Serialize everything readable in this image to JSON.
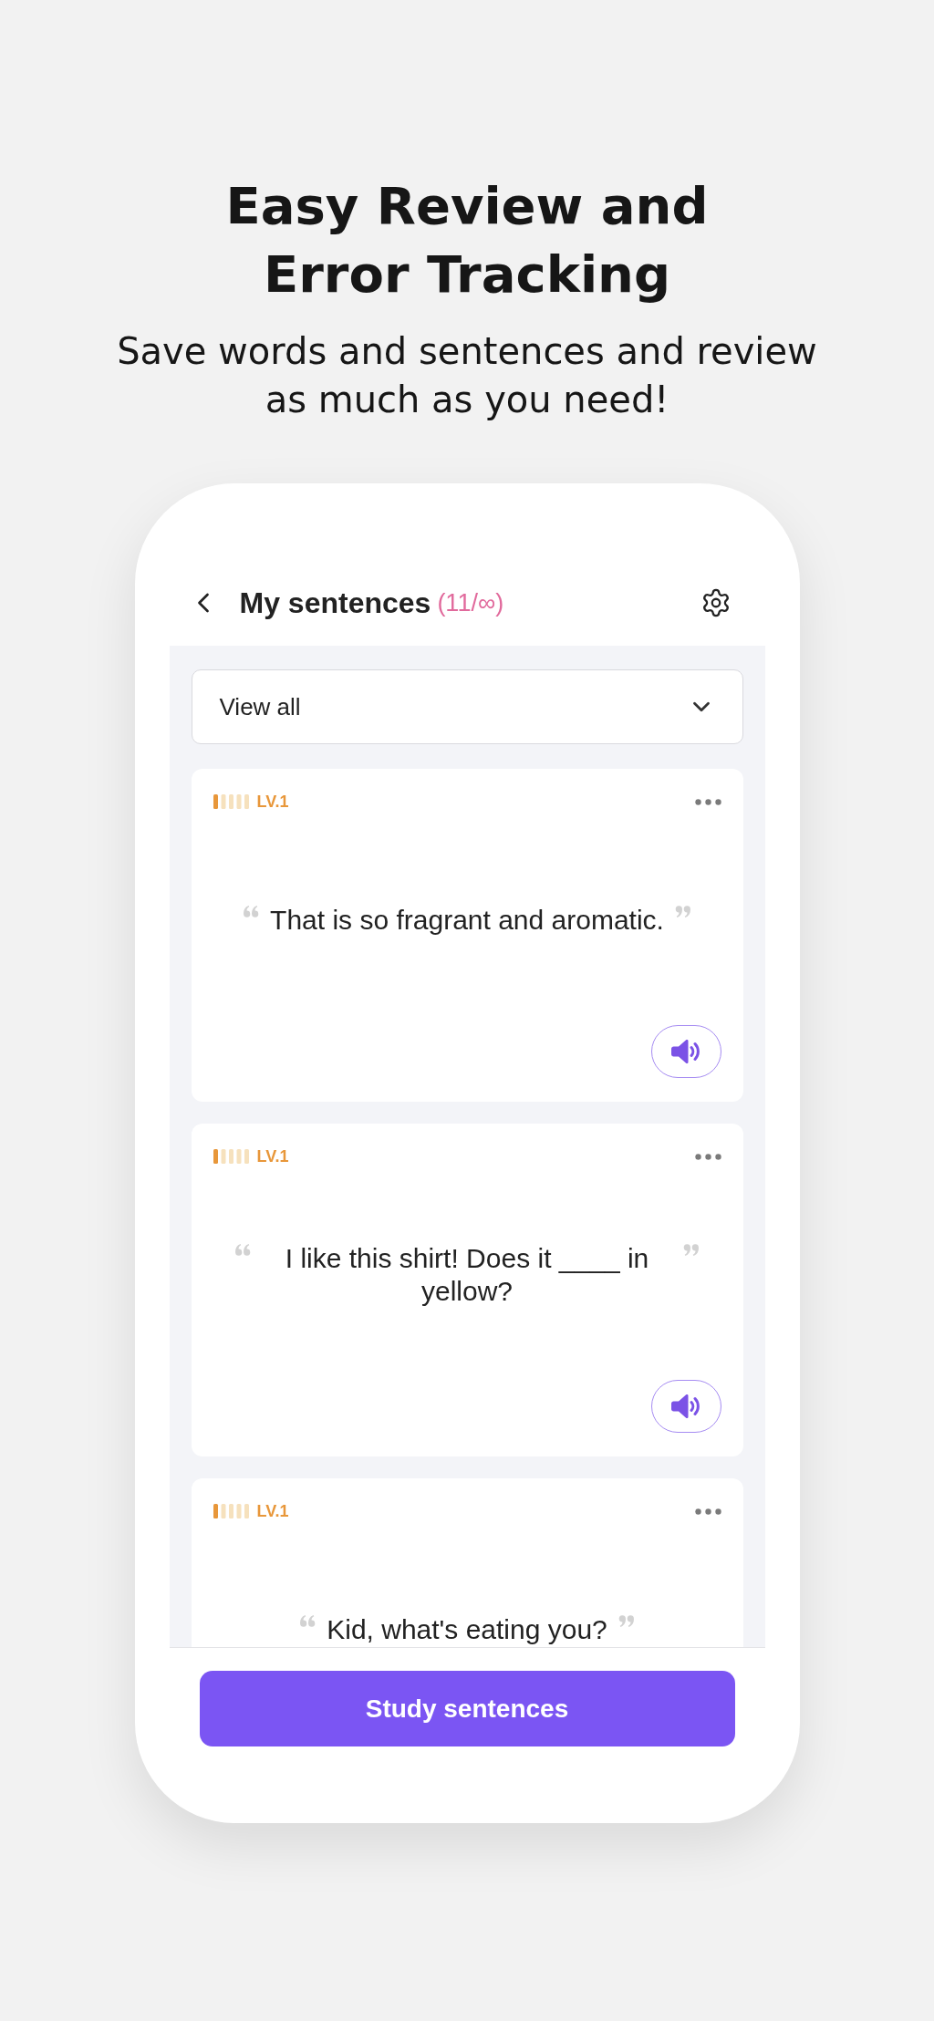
{
  "headline": {
    "title": "Easy Review and Error Tracking",
    "subtitle": "Save words and sentences and review as much as you need!"
  },
  "header": {
    "title": "My sentences",
    "count": "(11/∞)"
  },
  "filter": {
    "value": "View all"
  },
  "cards": [
    {
      "level": 0.2,
      "level_label": "LV.1",
      "sentence": "That is so fragrant and aromatic."
    },
    {
      "level": 0.2,
      "level_label": "LV.1",
      "sentence": "I like this shirt! Does it ____ in yellow?"
    },
    {
      "level": 0.2,
      "level_label": "LV.1",
      "sentence": "Kid, what's eating you?"
    }
  ],
  "study_button": {
    "label": "Study sentences"
  }
}
